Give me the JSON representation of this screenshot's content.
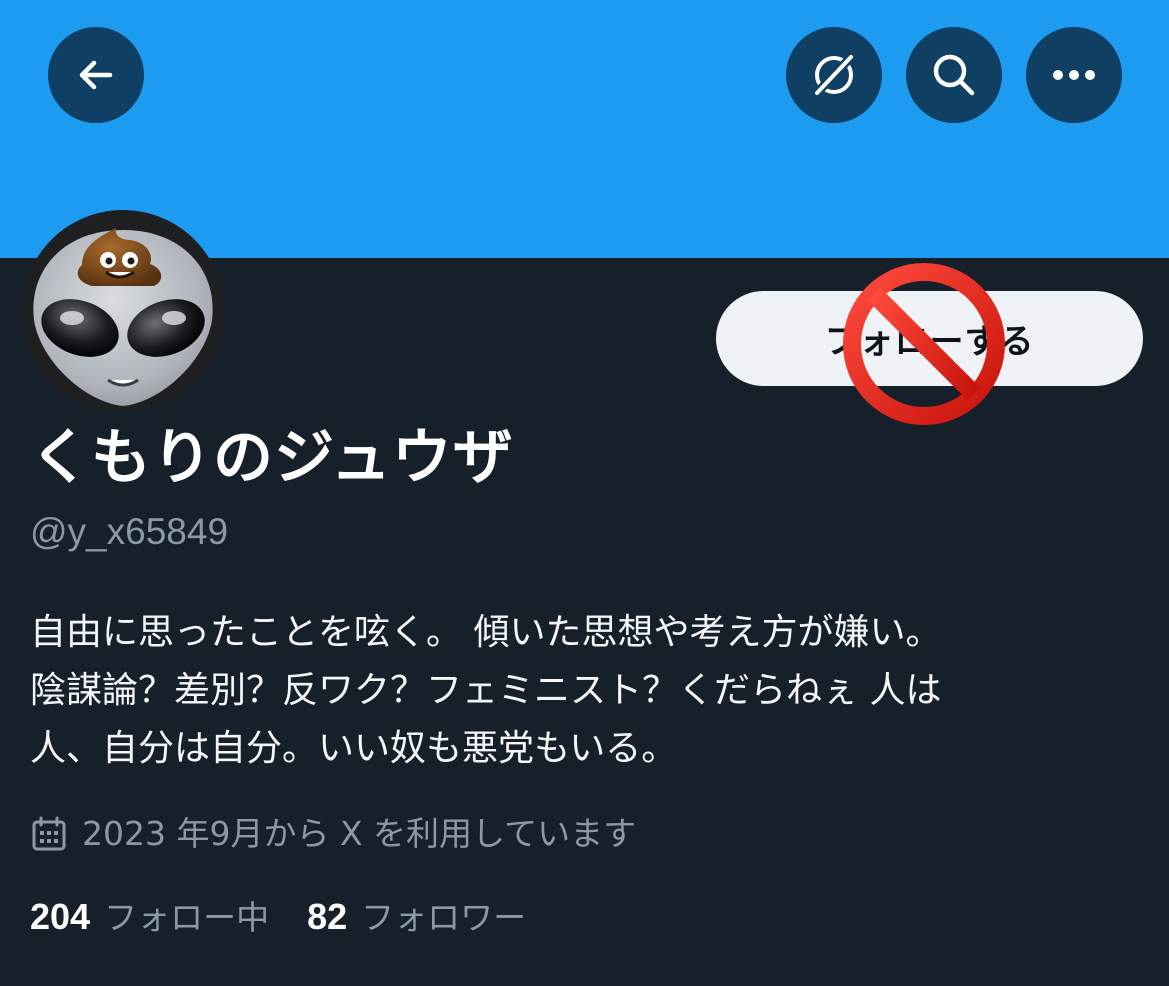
{
  "header": {
    "back_icon": "arrow-left-icon",
    "grok_icon": "grok-slash-icon",
    "search_icon": "search-icon",
    "more_icon": "more-dots-icon",
    "banner_color": "#1d9bf0"
  },
  "profile": {
    "display_name": "くもりのジュウザ",
    "handle": "@y_x65849",
    "follow_label": "フォローする",
    "bio_lines": [
      "自由に思ったことを呟く。 傾いた思想や考え方が嫌い。",
      "陰謀論？差別？反ワク？フェミニスト？くだらねぇ 人は",
      "人、自分は自分。いい奴も悪党もいる。"
    ],
    "joined": "2023 年9月から X を利用しています",
    "following_count": "204",
    "following_label": "フォロー中",
    "followers_count": "82",
    "followers_label": "フォロワー"
  },
  "overlay": {
    "prohibited_icon": "prohibited-sign-icon",
    "color": "#e0241b"
  }
}
